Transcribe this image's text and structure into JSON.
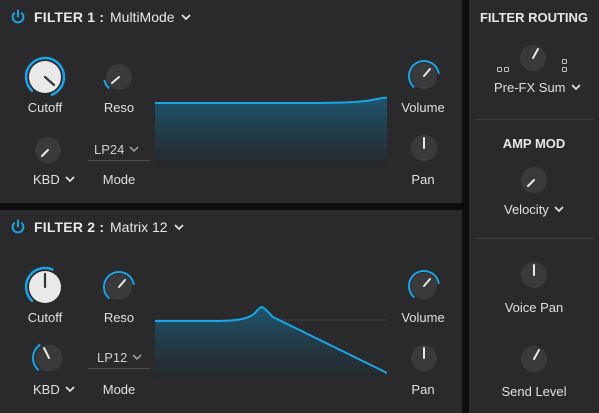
{
  "colors": {
    "accent": "#1aa4e6",
    "panel": "#2a2a2c",
    "knob_body": "#3a3a3c",
    "text": "#e4e4e4"
  },
  "filter1": {
    "title": "FILTER 1 :",
    "mode_value": "MultiMode",
    "cutoff_label": "Cutoff",
    "reso_label": "Reso",
    "volume_label": "Volume",
    "pan_label": "Pan",
    "kbd_label": "KBD",
    "mode_label": "Mode",
    "slope_value": "LP24"
  },
  "filter2": {
    "title": "FILTER 2 :",
    "mode_value": "Matrix 12",
    "cutoff_label": "Cutoff",
    "reso_label": "Reso",
    "volume_label": "Volume",
    "pan_label": "Pan",
    "kbd_label": "KBD",
    "mode_label": "Mode",
    "slope_value": "LP12"
  },
  "routing": {
    "title": "FILTER ROUTING",
    "value": "Pre-FX Sum"
  },
  "amp_mod": {
    "title": "AMP MOD",
    "value": "Velocity"
  },
  "voice_pan_label": "Voice Pan",
  "send_level_label": "Send Level",
  "icons": {
    "power": "power-icon",
    "chevron": "chevron-down-icon",
    "routing_serial": "serial-routing-icon",
    "routing_parallel": "parallel-routing-icon"
  }
}
